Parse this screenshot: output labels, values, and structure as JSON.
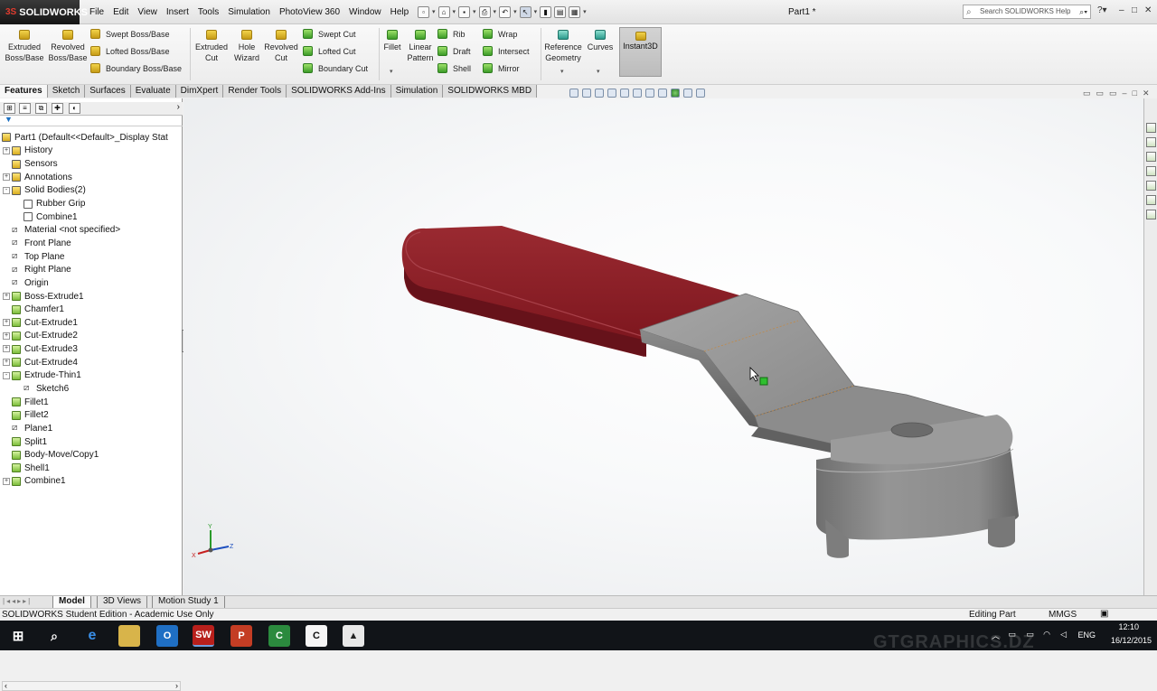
{
  "app": {
    "logo_text": "SOLIDWORKS",
    "logo_prefix": "3S",
    "document_title": "Part1 *"
  },
  "menu": [
    "File",
    "Edit",
    "View",
    "Insert",
    "Tools",
    "Simulation",
    "PhotoView 360",
    "Window",
    "Help"
  ],
  "search": {
    "placeholder": "Search SOLIDWORKS Help"
  },
  "ribbon": {
    "extruded_boss": "Extruded Boss/Base",
    "revolved_boss": "Revolved Boss/Base",
    "swept_boss": "Swept Boss/Base",
    "lofted_boss": "Lofted Boss/Base",
    "boundary_boss": "Boundary Boss/Base",
    "extruded_cut": "Extruded Cut",
    "hole_wizard": "Hole Wizard",
    "revolved_cut": "Revolved Cut",
    "swept_cut": "Swept Cut",
    "lofted_cut": "Lofted Cut",
    "boundary_cut": "Boundary Cut",
    "fillet": "Fillet",
    "linear_pattern": "Linear Pattern",
    "rib": "Rib",
    "draft": "Draft",
    "shell": "Shell",
    "wrap": "Wrap",
    "intersect": "Intersect",
    "mirror": "Mirror",
    "reference_geometry": "Reference Geometry",
    "curves": "Curves",
    "instant3d": "Instant3D"
  },
  "command_tabs": [
    "Features",
    "Sketch",
    "Surfaces",
    "Evaluate",
    "DimXpert",
    "Render Tools",
    "SOLIDWORKS Add-Ins",
    "Simulation",
    "SOLIDWORKS MBD"
  ],
  "tree": [
    {
      "label": "Part1  (Default<<Default>_Display Stat",
      "icon": "part-icon",
      "kind": "root"
    },
    {
      "label": "History",
      "icon": "history-folder-icon",
      "kind": "folder",
      "expand": "+"
    },
    {
      "label": "Sensors",
      "icon": "sensors-folder-icon",
      "kind": "folder"
    },
    {
      "label": "Annotations",
      "icon": "annotations-icon",
      "kind": "folder",
      "expand": "+"
    },
    {
      "label": "Solid Bodies(2)",
      "icon": "solid-bodies-folder-icon",
      "kind": "folder",
      "expand": "-"
    },
    {
      "label": "Rubber Grip",
      "icon": "body-icon",
      "kind": "body",
      "indent": 1
    },
    {
      "label": "Combine1",
      "icon": "body-icon",
      "kind": "body",
      "indent": 1
    },
    {
      "label": "Material <not specified>",
      "icon": "material-icon",
      "kind": "plane"
    },
    {
      "label": "Front Plane",
      "icon": "plane-icon",
      "kind": "plane"
    },
    {
      "label": "Top Plane",
      "icon": "plane-icon",
      "kind": "plane"
    },
    {
      "label": "Right Plane",
      "icon": "plane-icon",
      "kind": "plane"
    },
    {
      "label": "Origin",
      "icon": "origin-icon",
      "kind": "plane"
    },
    {
      "label": "Boss-Extrude1",
      "icon": "extrude-icon",
      "kind": "feat",
      "expand": "+"
    },
    {
      "label": "Chamfer1",
      "icon": "chamfer-icon",
      "kind": "feat"
    },
    {
      "label": "Cut-Extrude1",
      "icon": "cut-extrude-icon",
      "kind": "feat",
      "expand": "+"
    },
    {
      "label": "Cut-Extrude2",
      "icon": "cut-extrude-icon",
      "kind": "feat",
      "expand": "+"
    },
    {
      "label": "Cut-Extrude3",
      "icon": "cut-extrude-icon",
      "kind": "feat",
      "expand": "+"
    },
    {
      "label": "Cut-Extrude4",
      "icon": "cut-extrude-icon",
      "kind": "feat",
      "expand": "+"
    },
    {
      "label": "Extrude-Thin1",
      "icon": "extrude-thin-icon",
      "kind": "feat",
      "expand": "-"
    },
    {
      "label": "Sketch6",
      "icon": "sketch-icon",
      "kind": "plane",
      "indent": 1
    },
    {
      "label": "Fillet1",
      "icon": "fillet-icon",
      "kind": "feat"
    },
    {
      "label": "Fillet2",
      "icon": "fillet-icon",
      "kind": "feat"
    },
    {
      "label": "Plane1",
      "icon": "plane-icon",
      "kind": "plane"
    },
    {
      "label": "Split1",
      "icon": "split-icon",
      "kind": "feat"
    },
    {
      "label": "Body-Move/Copy1",
      "icon": "move-copy-icon",
      "kind": "feat"
    },
    {
      "label": "Shell1",
      "icon": "shell-icon",
      "kind": "feat"
    },
    {
      "label": "Combine1",
      "icon": "combine-icon",
      "kind": "feat",
      "expand": "+"
    }
  ],
  "bottom_tabs": [
    "Model",
    "3D Views",
    "Motion Study 1"
  ],
  "status": {
    "left": "SOLIDWORKS Student Edition - Academic Use Only",
    "mode": "Editing Part",
    "units": "MMGS"
  },
  "triad": {
    "x": "X",
    "y": "Y",
    "z": "Z"
  },
  "model_colors": {
    "grip": "#7f1820",
    "metal": "#8e8e8e",
    "background": "#f6f7f8"
  },
  "taskbar": {
    "language": "ENG",
    "time": "12:10",
    "date": "16/12/2015"
  },
  "watermark": "GTGRAPHICS.DZ"
}
